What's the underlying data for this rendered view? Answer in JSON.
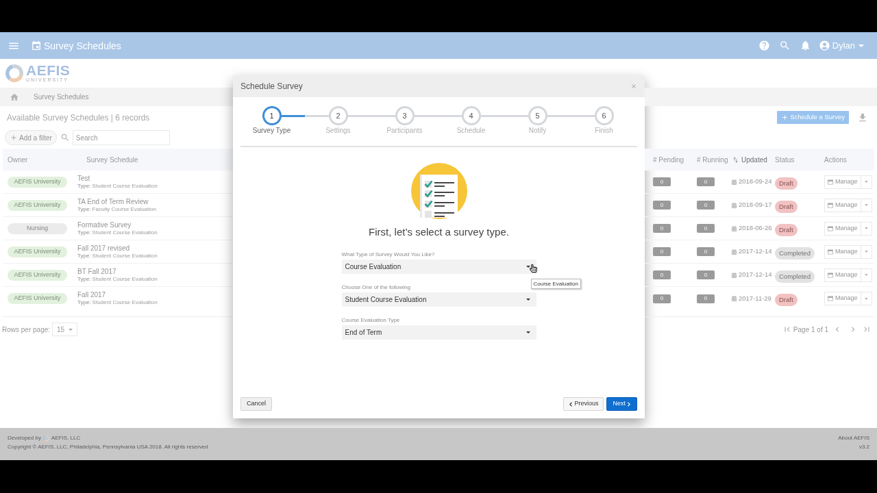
{
  "app_bar": {
    "title": "Survey Schedules",
    "user": "Dylan"
  },
  "logo": {
    "name": "AEFIS",
    "subtitle": "UNIVERSITY"
  },
  "breadcrumb": {
    "items": [
      "Survey Schedules"
    ]
  },
  "page_header": {
    "title": "Available Survey Schedules | 6 records",
    "action_button": "Schedule a Survey"
  },
  "filter_bar": {
    "add_filter": "Add a filter",
    "search": {
      "placeholder": "Search"
    }
  },
  "table": {
    "columns": [
      {
        "label": "Owner",
        "sorted": false
      },
      {
        "label": "Survey Schedule",
        "sorted": false
      },
      {
        "label": "# Pending",
        "sorted": false
      },
      {
        "label": "# Running",
        "sorted": false
      },
      {
        "label": "Updated",
        "sorted": true
      },
      {
        "label": "Status",
        "sorted": false
      },
      {
        "label": "Actions",
        "sorted": false
      }
    ],
    "rows": [
      {
        "owner": {
          "label": "AEFIS University",
          "color": "#e2f1dd"
        },
        "name": "Test",
        "type_label": "Type:",
        "type": "Student Course Evaluation",
        "pending": "0",
        "running": "0",
        "updated": "2018-09-24",
        "status": {
          "label": "Draft",
          "color": "#f2c2c2"
        },
        "action": "Manage"
      },
      {
        "owner": {
          "label": "AEFIS University",
          "color": "#e2f1dd"
        },
        "name": "TA End of Term Review",
        "type_label": "Type:",
        "type": "Faculty Course Evaluation",
        "pending": "0",
        "running": "0",
        "updated": "2018-09-17",
        "status": {
          "label": "Draft",
          "color": "#f2c2c2"
        },
        "action": "Manage"
      },
      {
        "owner": {
          "label": "Nursing",
          "color": "#ebebeb"
        },
        "name": "Formative Survey",
        "type_label": "Type:",
        "type": "Student Course Evaluation",
        "pending": "0",
        "running": "0",
        "updated": "2018-06-26",
        "status": {
          "label": "Draft",
          "color": "#f2c2c2"
        },
        "action": "Manage"
      },
      {
        "owner": {
          "label": "AEFIS University",
          "color": "#e2f1dd"
        },
        "name": "Fall 2017 revised",
        "type_label": "Type:",
        "type": "Student Course Evaluation",
        "pending": "0",
        "running": "0",
        "updated": "2017-12-14",
        "status": {
          "label": "Completed",
          "color": "#e2e2e2"
        },
        "action": "Manage"
      },
      {
        "owner": {
          "label": "AEFIS University",
          "color": "#e2f1dd"
        },
        "name": "BT Fall 2017",
        "type_label": "Type:",
        "type": "Student Course Evaluation",
        "pending": "0",
        "running": "0",
        "updated": "2017-12-14",
        "status": {
          "label": "Completed",
          "color": "#e2e2e2"
        },
        "action": "Manage"
      },
      {
        "owner": {
          "label": "AEFIS University",
          "color": "#e2f1dd"
        },
        "name": "Fall 2017",
        "type_label": "Type:",
        "type": "Student Course Evaluation",
        "pending": "0",
        "running": "0",
        "updated": "2017-11-29",
        "status": {
          "label": "Draft",
          "color": "#f2c2c2"
        },
        "action": "Manage"
      }
    ]
  },
  "pagination": {
    "rows_per_page_label": "Rows per page:",
    "rows_per_page": "15",
    "page_info": "Page 1 of 1"
  },
  "dialog": {
    "title": "Schedule Survey",
    "steps": [
      {
        "number": "1",
        "label": "Survey Type",
        "selected": true
      },
      {
        "number": "2",
        "label": "Settings",
        "selected": false
      },
      {
        "number": "3",
        "label": "Participants",
        "selected": false
      },
      {
        "number": "4",
        "label": "Schedule",
        "selected": false
      },
      {
        "number": "5",
        "label": "Notify",
        "selected": false
      },
      {
        "number": "6",
        "label": "Finish",
        "selected": false
      }
    ],
    "heading": "First, let’s select a survey type.",
    "fields": [
      {
        "label": "What Type of Survey Would You Like?",
        "value": "Course Evaluation",
        "tooltip": "Course Evaluation"
      },
      {
        "label": "Choose One of the following",
        "value": "Student Course Evaluation"
      },
      {
        "label": "Course Evaluation Type",
        "value": "End of Term"
      }
    ],
    "buttons": {
      "cancel": "Cancel",
      "previous": "Previous",
      "next": "Next"
    }
  },
  "footer": {
    "developed_by": "Developed by",
    "company": "AEFIS, LLC",
    "copyright": "Copyright © AEFIS, LLC, Philadelphia, Pennsylvania USA 2018. All rights reserved",
    "about": "About AEFIS",
    "version": "v3.2"
  }
}
